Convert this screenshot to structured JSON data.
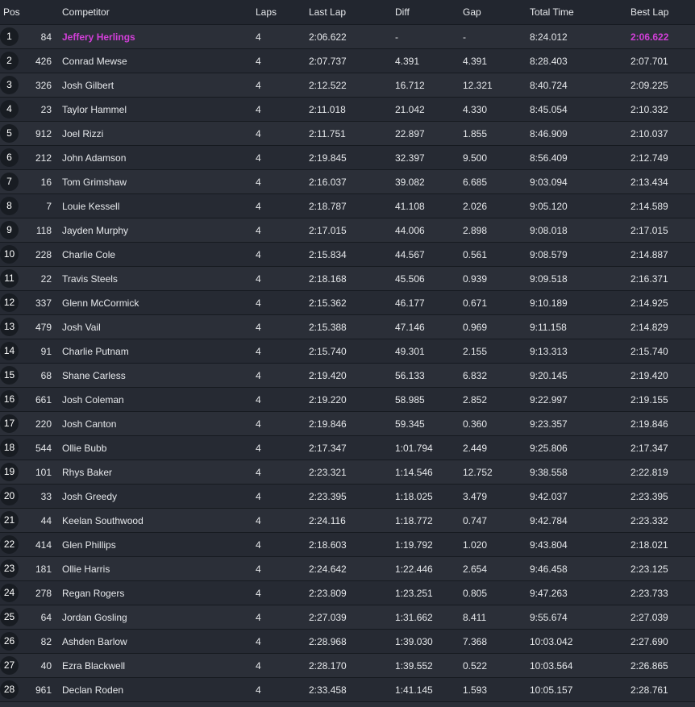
{
  "headers": {
    "pos": "Pos",
    "competitor": "Competitor",
    "laps": "Laps",
    "last_lap": "Last Lap",
    "diff": "Diff",
    "gap": "Gap",
    "total_time": "Total Time",
    "best_lap": "Best Lap"
  },
  "colors": {
    "background": "#22262f",
    "row_odd": "#2b2f38",
    "row_even": "#262a33",
    "highlight": "#d23fd8",
    "badge": "#181c22"
  },
  "rows": [
    {
      "pos": "1",
      "num": "84",
      "name": "Jeffery Herlings",
      "laps": "4",
      "last": "2:06.622",
      "diff": "-",
      "gap": "-",
      "total": "8:24.012",
      "best": "2:06.622"
    },
    {
      "pos": "2",
      "num": "426",
      "name": "Conrad Mewse",
      "laps": "4",
      "last": "2:07.737",
      "diff": "4.391",
      "gap": "4.391",
      "total": "8:28.403",
      "best": "2:07.701"
    },
    {
      "pos": "3",
      "num": "326",
      "name": "Josh Gilbert",
      "laps": "4",
      "last": "2:12.522",
      "diff": "16.712",
      "gap": "12.321",
      "total": "8:40.724",
      "best": "2:09.225"
    },
    {
      "pos": "4",
      "num": "23",
      "name": "Taylor Hammel",
      "laps": "4",
      "last": "2:11.018",
      "diff": "21.042",
      "gap": "4.330",
      "total": "8:45.054",
      "best": "2:10.332"
    },
    {
      "pos": "5",
      "num": "912",
      "name": "Joel Rizzi",
      "laps": "4",
      "last": "2:11.751",
      "diff": "22.897",
      "gap": "1.855",
      "total": "8:46.909",
      "best": "2:10.037"
    },
    {
      "pos": "6",
      "num": "212",
      "name": "John Adamson",
      "laps": "4",
      "last": "2:19.845",
      "diff": "32.397",
      "gap": "9.500",
      "total": "8:56.409",
      "best": "2:12.749"
    },
    {
      "pos": "7",
      "num": "16",
      "name": "Tom Grimshaw",
      "laps": "4",
      "last": "2:16.037",
      "diff": "39.082",
      "gap": "6.685",
      "total": "9:03.094",
      "best": "2:13.434"
    },
    {
      "pos": "8",
      "num": "7",
      "name": "Louie Kessell",
      "laps": "4",
      "last": "2:18.787",
      "diff": "41.108",
      "gap": "2.026",
      "total": "9:05.120",
      "best": "2:14.589"
    },
    {
      "pos": "9",
      "num": "118",
      "name": "Jayden Murphy",
      "laps": "4",
      "last": "2:17.015",
      "diff": "44.006",
      "gap": "2.898",
      "total": "9:08.018",
      "best": "2:17.015"
    },
    {
      "pos": "10",
      "num": "228",
      "name": "Charlie Cole",
      "laps": "4",
      "last": "2:15.834",
      "diff": "44.567",
      "gap": "0.561",
      "total": "9:08.579",
      "best": "2:14.887"
    },
    {
      "pos": "11",
      "num": "22",
      "name": "Travis Steels",
      "laps": "4",
      "last": "2:18.168",
      "diff": "45.506",
      "gap": "0.939",
      "total": "9:09.518",
      "best": "2:16.371"
    },
    {
      "pos": "12",
      "num": "337",
      "name": "Glenn McCormick",
      "laps": "4",
      "last": "2:15.362",
      "diff": "46.177",
      "gap": "0.671",
      "total": "9:10.189",
      "best": "2:14.925"
    },
    {
      "pos": "13",
      "num": "479",
      "name": "Josh Vail",
      "laps": "4",
      "last": "2:15.388",
      "diff": "47.146",
      "gap": "0.969",
      "total": "9:11.158",
      "best": "2:14.829"
    },
    {
      "pos": "14",
      "num": "91",
      "name": "Charlie Putnam",
      "laps": "4",
      "last": "2:15.740",
      "diff": "49.301",
      "gap": "2.155",
      "total": "9:13.313",
      "best": "2:15.740"
    },
    {
      "pos": "15",
      "num": "68",
      "name": "Shane Carless",
      "laps": "4",
      "last": "2:19.420",
      "diff": "56.133",
      "gap": "6.832",
      "total": "9:20.145",
      "best": "2:19.420"
    },
    {
      "pos": "16",
      "num": "661",
      "name": "Josh Coleman",
      "laps": "4",
      "last": "2:19.220",
      "diff": "58.985",
      "gap": "2.852",
      "total": "9:22.997",
      "best": "2:19.155"
    },
    {
      "pos": "17",
      "num": "220",
      "name": "Josh Canton",
      "laps": "4",
      "last": "2:19.846",
      "diff": "59.345",
      "gap": "0.360",
      "total": "9:23.357",
      "best": "2:19.846"
    },
    {
      "pos": "18",
      "num": "544",
      "name": "Ollie Bubb",
      "laps": "4",
      "last": "2:17.347",
      "diff": "1:01.794",
      "gap": "2.449",
      "total": "9:25.806",
      "best": "2:17.347"
    },
    {
      "pos": "19",
      "num": "101",
      "name": "Rhys Baker",
      "laps": "4",
      "last": "2:23.321",
      "diff": "1:14.546",
      "gap": "12.752",
      "total": "9:38.558",
      "best": "2:22.819"
    },
    {
      "pos": "20",
      "num": "33",
      "name": "Josh Greedy",
      "laps": "4",
      "last": "2:23.395",
      "diff": "1:18.025",
      "gap": "3.479",
      "total": "9:42.037",
      "best": "2:23.395"
    },
    {
      "pos": "21",
      "num": "44",
      "name": "Keelan Southwood",
      "laps": "4",
      "last": "2:24.116",
      "diff": "1:18.772",
      "gap": "0.747",
      "total": "9:42.784",
      "best": "2:23.332"
    },
    {
      "pos": "22",
      "num": "414",
      "name": "Glen Phillips",
      "laps": "4",
      "last": "2:18.603",
      "diff": "1:19.792",
      "gap": "1.020",
      "total": "9:43.804",
      "best": "2:18.021"
    },
    {
      "pos": "23",
      "num": "181",
      "name": "Ollie Harris",
      "laps": "4",
      "last": "2:24.642",
      "diff": "1:22.446",
      "gap": "2.654",
      "total": "9:46.458",
      "best": "2:23.125"
    },
    {
      "pos": "24",
      "num": "278",
      "name": "Regan Rogers",
      "laps": "4",
      "last": "2:23.809",
      "diff": "1:23.251",
      "gap": "0.805",
      "total": "9:47.263",
      "best": "2:23.733"
    },
    {
      "pos": "25",
      "num": "64",
      "name": "Jordan Gosling",
      "laps": "4",
      "last": "2:27.039",
      "diff": "1:31.662",
      "gap": "8.411",
      "total": "9:55.674",
      "best": "2:27.039"
    },
    {
      "pos": "26",
      "num": "82",
      "name": "Ashden Barlow",
      "laps": "4",
      "last": "2:28.968",
      "diff": "1:39.030",
      "gap": "7.368",
      "total": "10:03.042",
      "best": "2:27.690"
    },
    {
      "pos": "27",
      "num": "40",
      "name": "Ezra Blackwell",
      "laps": "4",
      "last": "2:28.170",
      "diff": "1:39.552",
      "gap": "0.522",
      "total": "10:03.564",
      "best": "2:26.865"
    },
    {
      "pos": "28",
      "num": "961",
      "name": "Declan Roden",
      "laps": "4",
      "last": "2:33.458",
      "diff": "1:41.145",
      "gap": "1.593",
      "total": "10:05.157",
      "best": "2:28.761"
    }
  ]
}
